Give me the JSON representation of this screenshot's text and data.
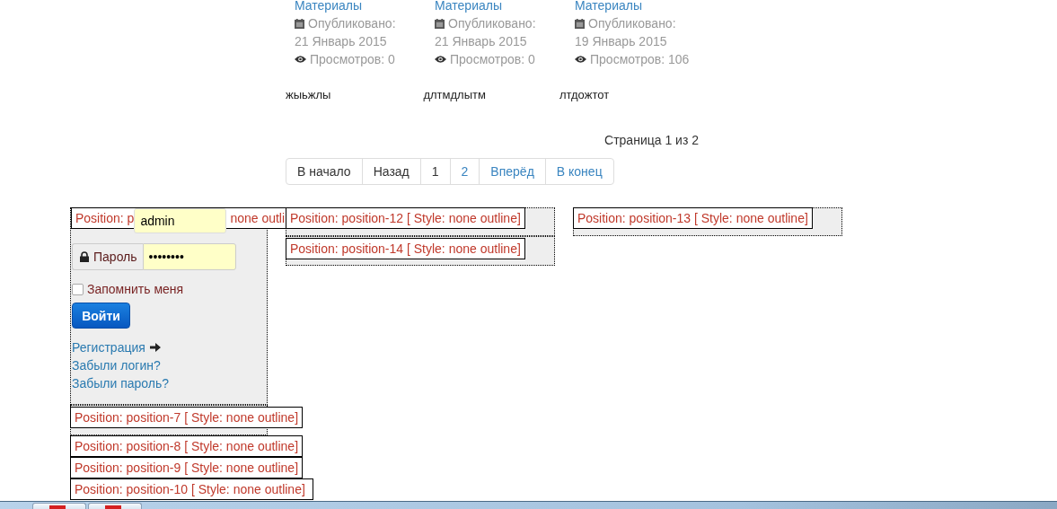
{
  "articles": [
    {
      "category": "Материалы",
      "published_label": "Опубликовано:",
      "date": "21 Январь 2015",
      "views": "Просмотров: 0"
    },
    {
      "category": "Материалы",
      "published_label": "Опубликовано:",
      "date": "21 Январь 2015",
      "views": "Просмотров: 0"
    },
    {
      "category": "Материалы",
      "published_label": "Опубликовано:",
      "date": "19 Январь 2015",
      "views": "Просмотров: 106"
    }
  ],
  "titles": [
    "жыьжлы",
    "длтмдлытм",
    "лтдожтот"
  ],
  "page_info": "Страница 1 из 2",
  "pagination": [
    {
      "label": "В начало",
      "disabled": true
    },
    {
      "label": "Назад",
      "disabled": true
    },
    {
      "label": "1",
      "disabled": true
    },
    {
      "label": "2",
      "disabled": false
    },
    {
      "label": "Вперёд",
      "disabled": false
    },
    {
      "label": "В конец",
      "disabled": false
    }
  ],
  "login": {
    "position_label_parts": [
      "Position: p",
      "none outli"
    ],
    "username": "admin",
    "password_label": "Пароль",
    "password": "••••••••",
    "remember_label": "Запомнить меня",
    "remember": false,
    "submit": "Войти",
    "links": [
      {
        "label": "Регистрация",
        "arrow": true
      },
      {
        "label": "Забыли логин?",
        "arrow": false
      },
      {
        "label": "Забыли пароль?",
        "arrow": false
      }
    ]
  },
  "left_positions": [
    "Position: position-7 [ Style: none outline]",
    "Position: position-8 [ Style: none outline]",
    "Position: position-9 [ Style: none outline]",
    "Position: position-10 [ Style: none outline]"
  ],
  "middle_positions": [
    "Position: position-12 [ Style: none outline]",
    "Position: position-14 [ Style: none outline]"
  ],
  "right_positions": [
    "Position: position-13 [ Style: none outline]"
  ]
}
